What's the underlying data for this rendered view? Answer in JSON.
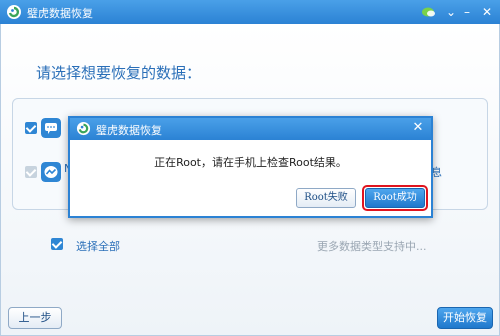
{
  "window": {
    "title": "璧虎数据恢复",
    "controls": [
      "wechat-icon",
      "chevron-icon",
      "minimize-icon",
      "close-icon"
    ]
  },
  "main": {
    "heading": "请选择想要恢复的数据：",
    "data_types": [
      {
        "icon": "sms-icon",
        "color": "#2f86d4",
        "checked": true,
        "dimmed": false
      },
      {
        "icon": "messenger-icon",
        "color": "#2f86d4",
        "checked": true,
        "dimmed": true,
        "partial_label": "N"
      }
    ],
    "right_fragment": "息",
    "select_all_label": "选择全部",
    "select_all_checked": true,
    "more_types_text": "更多数据类型支持中..."
  },
  "footer": {
    "prev_button": "上一步",
    "start_button": "开始恢复"
  },
  "dialog": {
    "title": "璧虎数据恢复",
    "message": "正在Root，请在手机上检查Root结果。",
    "fail_button": "Root失败",
    "success_button": "Root成功",
    "highlight_color": "#e0141e"
  },
  "colors": {
    "accent": "#2b82d4",
    "heading": "#2a6fb8"
  }
}
